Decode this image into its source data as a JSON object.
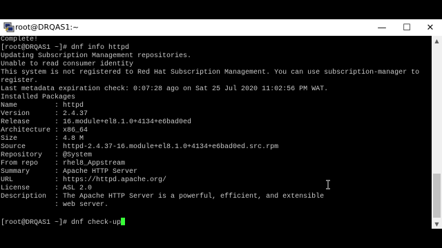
{
  "window": {
    "title": "root@DRQAS1:~",
    "controls": {
      "minimize": "—",
      "maximize": "☐",
      "close": "✕"
    }
  },
  "terminal": {
    "lines": [
      "Complete!",
      "[root@DRQAS1 ~]# dnf info httpd",
      "Updating Subscription Management repositories.",
      "Unable to read consumer identity",
      "This system is not registered to Red Hat Subscription Management. You can use subscription-manager to",
      "register.",
      "Last metadata expiration check: 0:07:28 ago on Sat 25 Jul 2020 11:02:56 PM WAT.",
      "Installed Packages",
      "Name         : httpd",
      "Version      : 2.4.37",
      "Release      : 16.module+el8.1.0+4134+e6bad0ed",
      "Architecture : x86_64",
      "Size         : 4.8 M",
      "Source       : httpd-2.4.37-16.module+el8.1.0+4134+e6bad0ed.src.rpm",
      "Repository   : @System",
      "From repo    : rhel8_Appstream",
      "Summary      : Apache HTTP Server",
      "URL          : https://httpd.apache.org/",
      "License      : ASL 2.0",
      "Description  : The Apache HTTP Server is a powerful, efficient, and extensible",
      "             : web server.",
      ""
    ],
    "prompt": "[root@DRQAS1 ~]# ",
    "current_input": "dnf check-up"
  },
  "colors": {
    "background": "#000000",
    "foreground": "#c8c8c8",
    "cursor": "#39ff39"
  },
  "icons": {
    "app": "putty-icon",
    "scroll_up": "scroll-up-arrow-icon",
    "scroll_down": "scroll-down-arrow-icon",
    "text_cursor": "ibeam-cursor-icon"
  }
}
